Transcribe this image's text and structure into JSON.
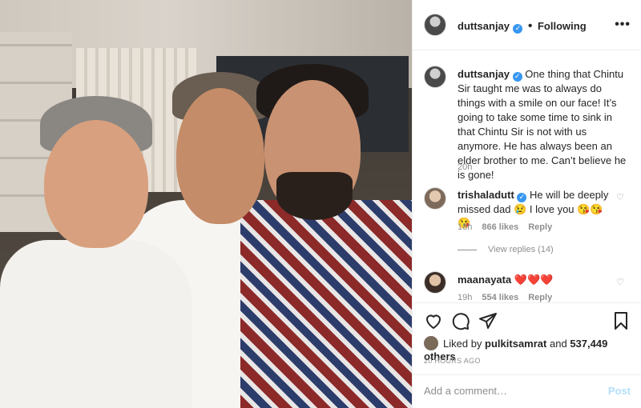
{
  "header": {
    "username": "duttsanjay",
    "separator": "•",
    "follow_label": "Following",
    "more_label": "•••"
  },
  "caption": {
    "username": "duttsanjay",
    "text": "One thing that Chintu Sir taught me was to always do things with a smile on our face! It’s going to take some time to sink in that Chintu Sir is not with us anymore. He has always been an elder brother to me. Can’t believe he is gone!",
    "time": "20h"
  },
  "comments": [
    {
      "username": "trishaladutt",
      "text": "He will be deeply missed dad 😢 I love you 😘😘😘",
      "time": "18h",
      "likes": "866 likes",
      "reply": "Reply",
      "view_replies": "View replies (14)"
    },
    {
      "username": "maanayata",
      "text": "❤️❤️❤️",
      "time": "19h",
      "likes": "554 likes",
      "reply": "Reply"
    }
  ],
  "likes": {
    "prefix": "Liked by",
    "user": "pulkitsamrat",
    "connector": "and",
    "count": "537,449 others"
  },
  "timestamp": "20 HOURS AGO",
  "add_comment": {
    "placeholder": "Add a comment…",
    "post_label": "Post"
  },
  "colors": {
    "verified": "#3897f0",
    "post": "#b2dffc",
    "muted": "#8e8e8e",
    "text": "#262626"
  }
}
